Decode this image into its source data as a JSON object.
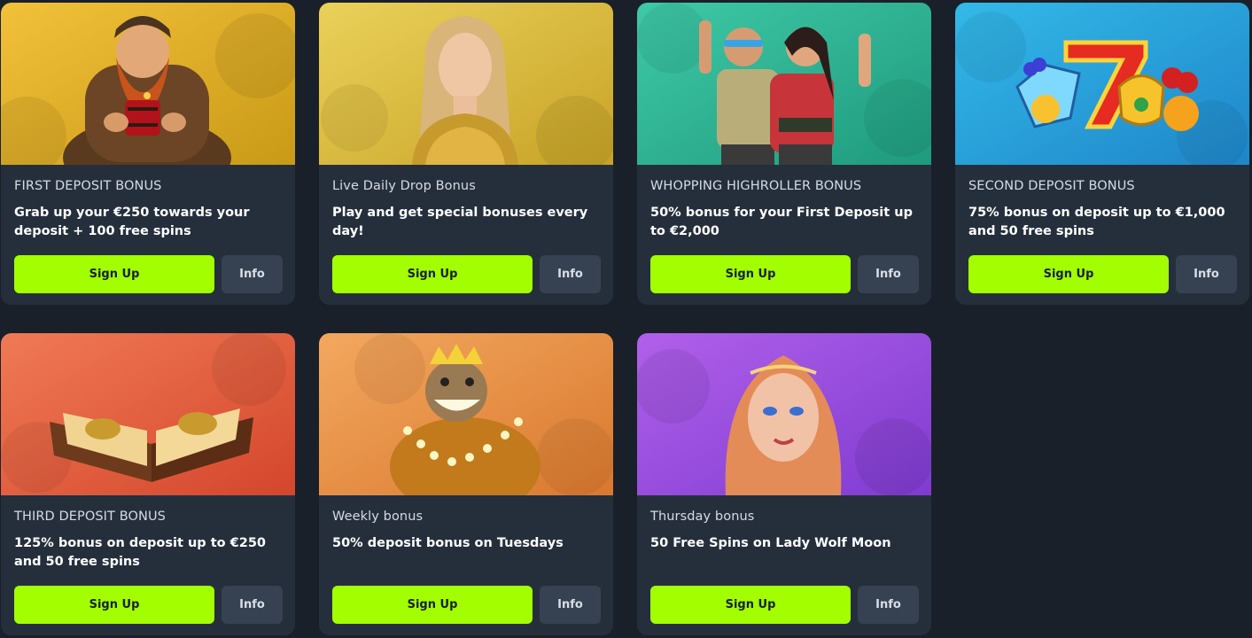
{
  "cards": [
    {
      "kicker": "FIRST DEPOSIT BONUS",
      "description": "Grab up your €250 towards your deposit + 100 free spins",
      "image": "dwarf-with-dynamite-illustration",
      "bg_from": "#f2c13a",
      "bg_to": "#c99a16",
      "signup_label": "Sign Up",
      "info_label": "Info"
    },
    {
      "kicker": "Live Daily Drop Bonus",
      "description": "Play and get special bonuses every day!",
      "image": "live-dealer-woman-illustration",
      "bg_from": "#ead15a",
      "bg_to": "#c8a326",
      "signup_label": "Sign Up",
      "info_label": "Info"
    },
    {
      "kicker": "WHOPPING HIGHROLLER BONUS",
      "description": "50% bonus for your First Deposit up to €2,000",
      "image": "adventurers-duo-illustration",
      "bg_from": "#3ec9a7",
      "bg_to": "#1f9a7d",
      "signup_label": "Sign Up",
      "info_label": "Info"
    },
    {
      "kicker": "SECOND DEPOSIT BONUS",
      "description": "75% bonus on deposit up to €1,000 and 50 free spins",
      "image": "lucky-seven-fruits-illustration",
      "bg_from": "#33b9e8",
      "bg_to": "#1e86c9",
      "signup_label": "Sign Up",
      "info_label": "Info"
    },
    {
      "kicker": "THIRD DEPOSIT BONUS",
      "description": "125% bonus on deposit up to €250 and 50 free spins",
      "image": "ancient-book-illustration",
      "bg_from": "#f07a55",
      "bg_to": "#d4462c",
      "signup_label": "Sign Up",
      "info_label": "Info"
    },
    {
      "kicker": "Weekly bonus",
      "description": "50% deposit bonus on Tuesdays",
      "image": "troll-king-illustration",
      "bg_from": "#f3a85f",
      "bg_to": "#d9782e",
      "signup_label": "Sign Up",
      "info_label": "Info"
    },
    {
      "kicker": "Thursday bonus",
      "description": "50 Free Spins on Lady Wolf Moon",
      "image": "lady-wolf-moon-illustration",
      "bg_from": "#b160ea",
      "bg_to": "#7f3bd0",
      "signup_label": "Sign Up",
      "info_label": "Info"
    }
  ],
  "colors": {
    "page_bg": "#1a2029",
    "card_bg": "#252f3c",
    "signup_bg": "#a3ff00",
    "info_bg": "#364252"
  }
}
